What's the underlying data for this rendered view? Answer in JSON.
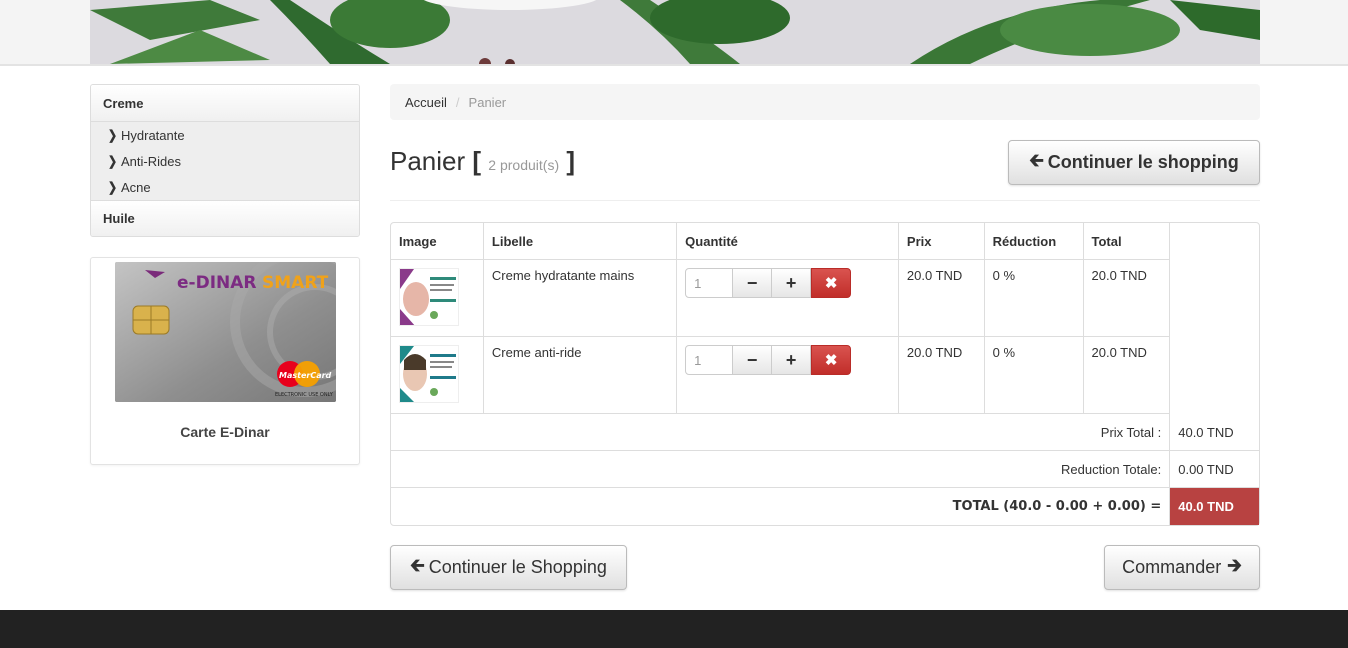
{
  "sidebar": {
    "categories": [
      {
        "label": "Creme",
        "items": [
          "Hydratante",
          "Anti-Rides",
          "Acne"
        ]
      },
      {
        "label": "Huile",
        "items": []
      }
    ],
    "card": {
      "caption": "Carte E-Dinar",
      "card_brand": "e-DINAR SMART",
      "card_network": "MasterCard"
    }
  },
  "breadcrumb": {
    "home": "Accueil",
    "separator": "/",
    "current": "Panier"
  },
  "page": {
    "title": "Panier",
    "count_text": "2 produit(s)",
    "continue_top": "Continuer le shopping",
    "continue_bottom": "Continuer le Shopping",
    "order": "Commander"
  },
  "table": {
    "headers": [
      "Image",
      "Libelle",
      "Quantité",
      "Prix",
      "Réduction",
      "Total"
    ],
    "rows": [
      {
        "label": "Creme hydratante mains",
        "qty": "1",
        "price": "20.0 TND",
        "discount": "0 %",
        "total": "20.0 TND"
      },
      {
        "label": "Creme anti-ride",
        "qty": "1",
        "price": "20.0 TND",
        "discount": "0 %",
        "total": "20.0 TND"
      }
    ],
    "summary": {
      "prix_total_label": "Prix Total :",
      "prix_total_value": "40.0 TND",
      "reduction_label": "Reduction Totale:",
      "reduction_value": "0.00 TND",
      "total_label": "TOTAL (40.0 - 0.00 + 0.00) =",
      "total_value": "40.0 TND"
    }
  },
  "icons": {
    "left_arrow": "arrow-left-icon",
    "right_arrow": "arrow-right-icon",
    "minus": "minus-icon",
    "plus": "plus-icon",
    "remove": "times-icon",
    "chevron": "chevron-right-icon"
  },
  "colors": {
    "danger": "#d9534f",
    "grand_total_bg": "#b84241",
    "footer": "#222222"
  }
}
